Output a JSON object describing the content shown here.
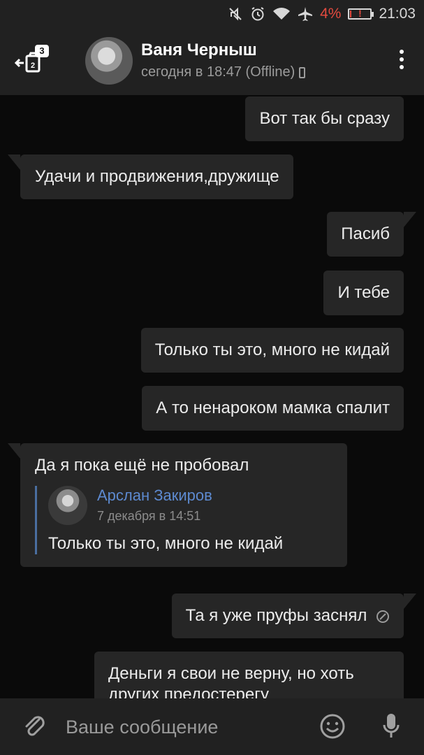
{
  "status_bar": {
    "battery_percent": "4%",
    "time": "21:03",
    "icons": [
      "mute-icon",
      "alarm-icon",
      "wifi-icon",
      "airplane-icon",
      "battery-low-icon"
    ]
  },
  "header": {
    "back_badge": "3",
    "contact_name": "Ваня Черныш",
    "contact_status": "сегодня в 18:47 (Offline)"
  },
  "messages": [
    {
      "dir": "out",
      "text": "Вот так бы сразу"
    },
    {
      "dir": "in",
      "text": "Удачи и продвижения,дружище"
    },
    {
      "dir": "out",
      "text": "Пасиб"
    },
    {
      "dir": "out",
      "text": "И тебе"
    },
    {
      "dir": "out",
      "text": "Только ты это, много не кидай"
    },
    {
      "dir": "out",
      "text": "А то ненароком мамка спалит"
    },
    {
      "dir": "in",
      "text": "Да я пока ещё не пробовал",
      "forward": {
        "author": "Арслан Закиров",
        "date": "7 декабря в 14:51",
        "text": "Только ты это, много не кидай"
      }
    },
    {
      "dir": "out",
      "text": "Та я уже пруфы заснял"
    },
    {
      "dir": "out",
      "text": "Деньги я свои не верну, но хоть других предостерегу"
    }
  ],
  "input": {
    "placeholder": "Ваше сообщение"
  },
  "colors": {
    "background": "#0a0a0a",
    "bar": "#212121",
    "bubble": "#262626",
    "link": "#5d8ad0",
    "battery_warning": "#e24a3f"
  }
}
